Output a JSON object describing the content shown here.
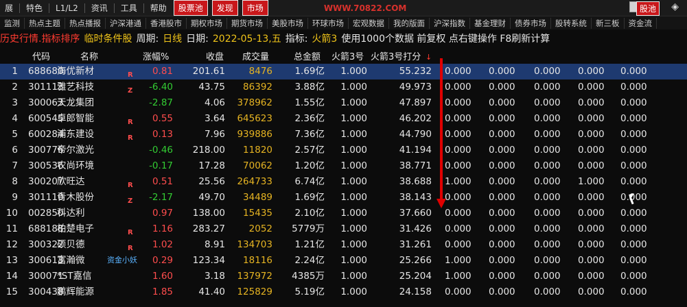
{
  "menubar": {
    "items": [
      "展",
      "特色",
      "L1/L2",
      "资讯",
      "工具",
      "帮助"
    ],
    "red_buttons": [
      "股票池",
      "发现",
      "市场"
    ],
    "banner": "WWW.70822.COM",
    "pool_button": "股池",
    "layers_icon": "layers-icon"
  },
  "tabs": [
    "监测",
    "热点主题",
    "热点播报",
    "沪深港通",
    "香港股市",
    "期权市场",
    "期货市场",
    "美股市场",
    "环球市场",
    "宏观数据",
    "我的版面",
    "沪深指数",
    "基金理财",
    "债券市场",
    "股转系统",
    "新三板",
    "资金流"
  ],
  "info": {
    "history": "历史行情.指标排序",
    "cond": "临时条件股",
    "period_label": "周期:",
    "period": "日线",
    "date_label": "日期:",
    "date": "2022-05-13,五",
    "indicator_label": "指标:",
    "indicator": "火箭3",
    "note": "使用1000个数据 前复权 点右键操作 F8刷新计算"
  },
  "headers": [
    "代码",
    "名称",
    "涨幅%",
    "收盘",
    "成交量",
    "总金额",
    "火箭3号",
    "火箭3号打分",
    "↓"
  ],
  "rows": [
    {
      "idx": "1",
      "code": "688680",
      "name": "海优新材",
      "flag": "R",
      "chg": "0.81",
      "dir": "up",
      "close": "201.61",
      "vol": "8476",
      "amt": "1.69亿",
      "v1": "1.000",
      "score": "55.232",
      "c": [
        "0.000",
        "0.000",
        "0.000",
        "0.000",
        "0.000"
      ]
    },
    {
      "idx": "2",
      "code": "301113",
      "name": "雅艺科技",
      "flag": "Z",
      "chg": "-6.40",
      "dir": "dn",
      "close": "43.75",
      "vol": "86392",
      "amt": "3.88亿",
      "v1": "1.000",
      "score": "49.973",
      "c": [
        "0.000",
        "0.000",
        "0.000",
        "0.000",
        "0.000"
      ]
    },
    {
      "idx": "3",
      "code": "300063",
      "name": "天龙集团",
      "flag": "",
      "chg": "-2.87",
      "dir": "dn",
      "close": "4.06",
      "vol": "378962",
      "amt": "1.55亿",
      "v1": "1.000",
      "score": "47.897",
      "c": [
        "0.000",
        "0.000",
        "0.000",
        "0.000",
        "0.000"
      ]
    },
    {
      "idx": "4",
      "code": "600545",
      "name": "卓郎智能",
      "flag": "R",
      "chg": "0.55",
      "dir": "up",
      "close": "3.64",
      "vol": "645623",
      "amt": "2.36亿",
      "v1": "1.000",
      "score": "46.202",
      "c": [
        "0.000",
        "0.000",
        "0.000",
        "0.000",
        "0.000"
      ]
    },
    {
      "idx": "5",
      "code": "600284",
      "name": "浦东建设",
      "flag": "R",
      "chg": "0.13",
      "dir": "up",
      "close": "7.96",
      "vol": "939886",
      "amt": "7.36亿",
      "v1": "1.000",
      "score": "44.790",
      "c": [
        "0.000",
        "0.000",
        "0.000",
        "0.000",
        "0.000"
      ]
    },
    {
      "idx": "6",
      "code": "300776",
      "name": "帝尔激光",
      "flag": "",
      "chg": "-0.46",
      "dir": "dn",
      "close": "218.00",
      "vol": "11820",
      "amt": "2.57亿",
      "v1": "1.000",
      "score": "41.194",
      "c": [
        "0.000",
        "0.000",
        "0.000",
        "0.000",
        "0.000"
      ]
    },
    {
      "idx": "7",
      "code": "300536",
      "name": "农尚环境",
      "flag": "",
      "chg": "-0.17",
      "dir": "dn",
      "close": "17.28",
      "vol": "70062",
      "amt": "1.20亿",
      "v1": "1.000",
      "score": "38.771",
      "c": [
        "0.000",
        "0.000",
        "0.000",
        "0.000",
        "0.000"
      ]
    },
    {
      "idx": "8",
      "code": "300207",
      "name": "欣旺达",
      "flag": "R",
      "chg": "0.51",
      "dir": "up",
      "close": "25.56",
      "vol": "264733",
      "amt": "6.74亿",
      "v1": "1.000",
      "score": "38.688",
      "c": [
        "1.000",
        "0.000",
        "0.000",
        "1.000",
        "0.000"
      ]
    },
    {
      "idx": "9",
      "code": "301110",
      "name": "青木股份",
      "flag": "Z",
      "chg": "-2.17",
      "dir": "dn",
      "close": "49.70",
      "vol": "34489",
      "amt": "1.69亿",
      "v1": "1.000",
      "score": "38.143",
      "c": [
        "0.000",
        "0.000",
        "0.000",
        "0.000",
        "0.000"
      ]
    },
    {
      "idx": "10",
      "code": "002850",
      "name": "科达利",
      "flag": "",
      "chg": "0.97",
      "dir": "up",
      "close": "138.00",
      "vol": "15435",
      "amt": "2.10亿",
      "v1": "1.000",
      "score": "37.660",
      "c": [
        "0.000",
        "0.000",
        "0.000",
        "0.000",
        "0.000"
      ]
    },
    {
      "idx": "11",
      "code": "688188",
      "name": "柏楚电子",
      "flag": "R",
      "chg": "1.16",
      "dir": "up",
      "close": "283.27",
      "vol": "2052",
      "amt": "5779万",
      "v1": "1.000",
      "score": "31.426",
      "c": [
        "0.000",
        "0.000",
        "0.000",
        "0.000",
        "0.000"
      ]
    },
    {
      "idx": "12",
      "code": "300322",
      "name": "硕贝德",
      "flag": "R",
      "chg": "1.02",
      "dir": "up",
      "close": "8.91",
      "vol": "134703",
      "amt": "1.21亿",
      "v1": "1.000",
      "score": "31.261",
      "c": [
        "0.000",
        "0.000",
        "0.000",
        "0.000",
        "0.000"
      ]
    },
    {
      "idx": "13",
      "code": "300613",
      "name": "富瀚微",
      "flag": "",
      "tag": "资金小妖",
      "chg": "0.29",
      "dir": "up",
      "close": "123.34",
      "vol": "18116",
      "amt": "2.24亿",
      "v1": "1.000",
      "score": "25.266",
      "c": [
        "1.000",
        "0.000",
        "0.000",
        "0.000",
        "0.000"
      ]
    },
    {
      "idx": "14",
      "code": "300071",
      "name": "*ST嘉信",
      "flag": "",
      "chg": "1.60",
      "dir": "up",
      "close": "3.18",
      "vol": "137972",
      "amt": "4385万",
      "v1": "1.000",
      "score": "25.204",
      "c": [
        "1.000",
        "0.000",
        "0.000",
        "0.000",
        "0.000"
      ]
    },
    {
      "idx": "15",
      "code": "300438",
      "name": "鹏辉能源",
      "flag": "",
      "chg": "1.85",
      "dir": "up",
      "close": "41.40",
      "vol": "125829",
      "amt": "5.19亿",
      "v1": "1.000",
      "score": "24.158",
      "c": [
        "0.000",
        "0.000",
        "0.000",
        "0.000",
        "0.000"
      ]
    }
  ]
}
